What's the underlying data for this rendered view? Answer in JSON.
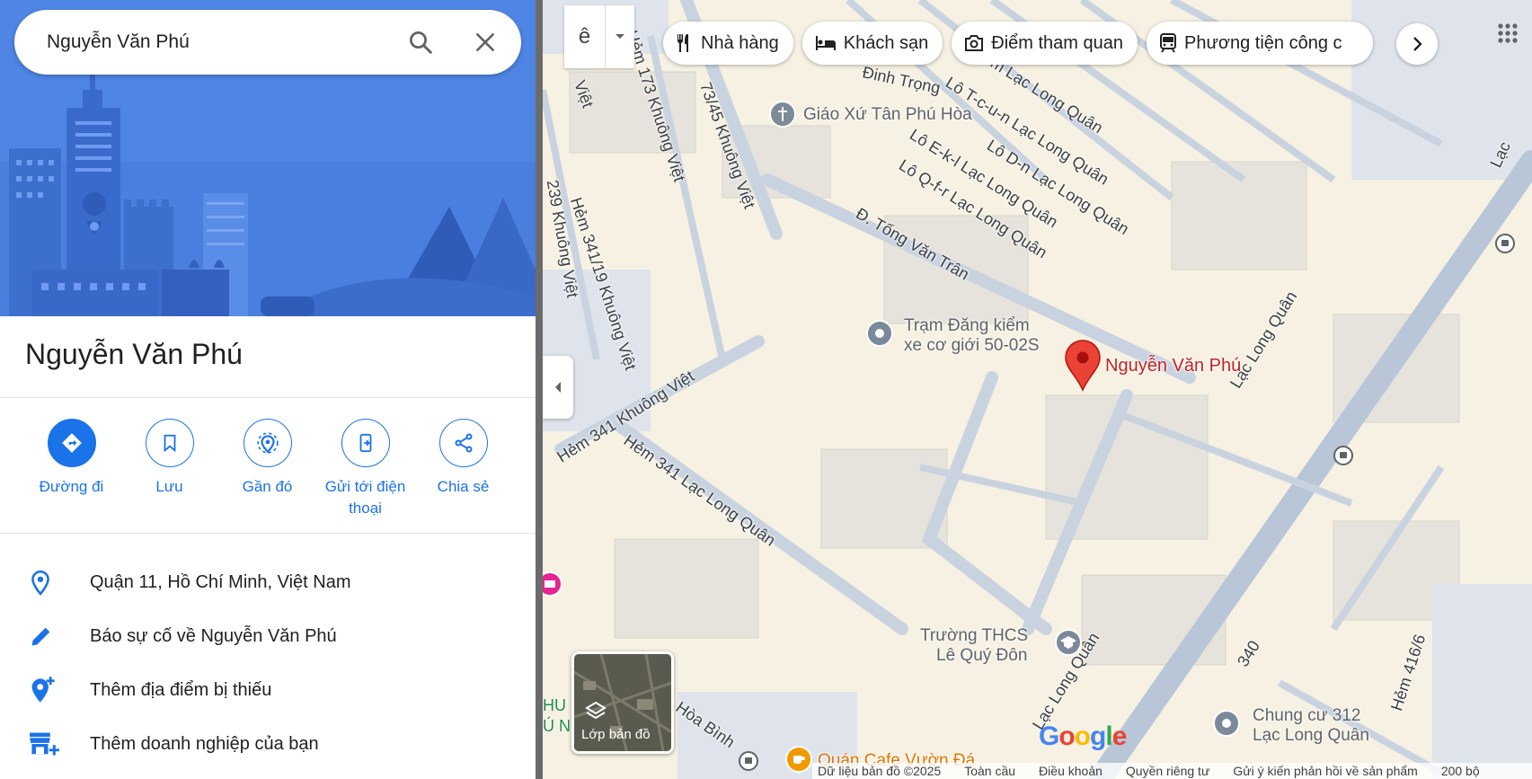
{
  "search": {
    "query": "Nguyễn Văn Phú"
  },
  "place": {
    "title": "Nguyễn Văn Phú"
  },
  "actions": [
    {
      "label": "Đường đi"
    },
    {
      "label": "Lưu"
    },
    {
      "label": "Gần đó"
    },
    {
      "label": "Gửi tới điện thoại"
    },
    {
      "label": "Chia sẻ"
    }
  ],
  "info": {
    "address": "Quận 11, Hồ Chí Minh, Việt Nam",
    "report": "Báo sự cố về Nguyễn Văn Phú",
    "add_place": "Thêm địa điểm bị thiếu",
    "add_business": "Thêm doanh nghiệp của bạn"
  },
  "map": {
    "lang_button": "ê",
    "chips": [
      {
        "label": "Nhà hàng",
        "icon": "restaurant-icon"
      },
      {
        "label": "Khách sạn",
        "icon": "hotel-icon"
      },
      {
        "label": "Điểm tham quan",
        "icon": "camera-icon"
      },
      {
        "label": "Phương tiện công c",
        "icon": "transit-icon"
      }
    ],
    "pin_label": "Nguyễn Văn Phú",
    "layers_label": "Lớp bản đồ",
    "pois": {
      "church": "Giáo Xứ Tân Phú Hòa",
      "inspection_1": "Trạm Đăng kiểm",
      "inspection_2": "xe cơ giới 50-02S",
      "school_1": "Trường THCS",
      "school_2": "Lê Quý Đôn",
      "apartment_1": "Chung cư 312",
      "apartment_2": "Lạc Long Quân",
      "cafe": "Quán Cafe Vườn Đá"
    },
    "streets": {
      "tong_van_tran": "Đ. Tống Văn Trân",
      "lac_long_quan_1": "Lạc Long Quân",
      "lac_long_quan_2": "Lạc Long Quân",
      "hem_341_khuong_viet": "Hẻm 341 Khuông Việt",
      "hem_341_llq": "Hẻm 341 Lạc Long Quân",
      "hem_173": "Hẻm 173 Khuông Việt",
      "hem_73_45": "73/45 Khuông Việt",
      "hem_341_19": "Hẻm 341/19 Khuông Việt",
      "hem_239": "239 Khuông Việt",
      "lo_tcun": "Lô T-c-u-n Lạc Long Quân",
      "lo_dn": "Lô D-n Lạc Long Quân",
      "lo_ekl": "Lô E-k-l Lạc Long Quân",
      "lo_qfr": "Lô Q-f-r Lạc Long Quân",
      "lo_m": "m Lạc Long Quân",
      "dinh_trong": "Đinh Trọng",
      "hoa_binh": "Hòa Bình",
      "hem_416": "Hẻm 416/6",
      "n340": "340",
      "viet": "Việt",
      "lac": "Lạc",
      "hu": "HU",
      "un": "Ú N"
    },
    "google_logo": "Google",
    "footer": {
      "data": "Dữ liệu bản đồ ©2025",
      "global": "Toàn cầu",
      "terms": "Điều khoản",
      "privacy": "Quyền riêng tư",
      "feedback": "Gửi ý kiến phản hồi về sản phẩm",
      "scale": "200 bộ"
    }
  },
  "colors": {
    "accent": "#1a73e8",
    "pin": "#ea4335",
    "hero": "#4a7fe0",
    "map_bg": "#f6f1e2",
    "road": "#c9d3e0"
  }
}
